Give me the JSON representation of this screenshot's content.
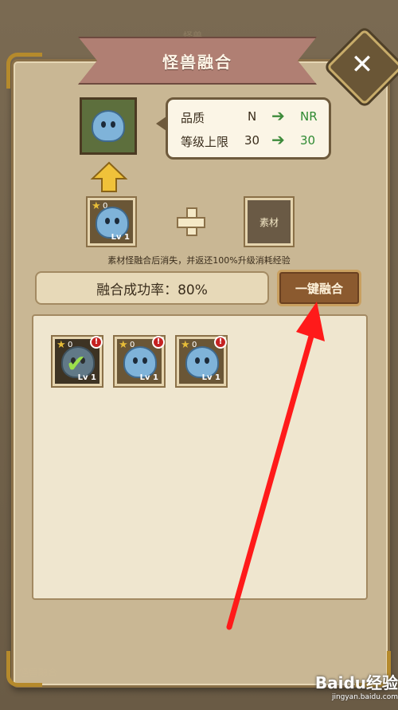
{
  "background": {
    "title": "怪兽",
    "bottom_label": "怪兽融合"
  },
  "dialog": {
    "title": "怪兽融合",
    "close_icon": "close-icon",
    "result": {
      "quality_label": "品质",
      "quality_from": "N",
      "quality_to": "NR",
      "level_cap_label": "等级上限",
      "level_from": "30",
      "level_to": "30"
    },
    "source_slot": {
      "stars": "0",
      "level": "Lv 1"
    },
    "material_slot": {
      "label": "素材"
    },
    "note": "素材怪融合后消失，并返还100%升级消耗经验",
    "success_rate": "融合成功率：80%",
    "fuse_button": "一键融合",
    "monsters": [
      {
        "stars": "0",
        "level": "Lv 1",
        "selected": true,
        "badge": "!"
      },
      {
        "stars": "0",
        "level": "Lv 1",
        "selected": false,
        "badge": "!"
      },
      {
        "stars": "0",
        "level": "Lv 1",
        "selected": false,
        "badge": "!"
      }
    ]
  },
  "watermark": {
    "brand": "Baidu经验",
    "url": "jingyan.baidu.com"
  },
  "colors": {
    "accent": "#8b5a2f",
    "quality_up": "#2f8a32",
    "alert": "#c52222",
    "pointer": "#ff1a1a"
  }
}
